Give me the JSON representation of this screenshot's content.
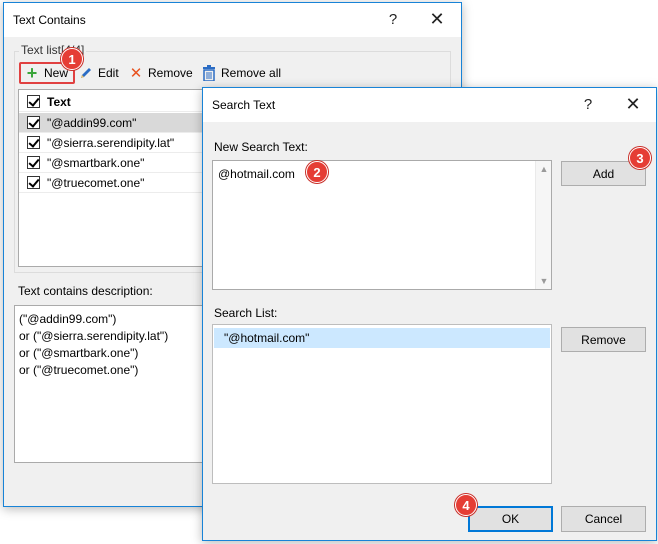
{
  "back_dialog": {
    "title": "Text Contains",
    "help": "?",
    "close": "✕",
    "group_label": "Text list[4/4]",
    "toolbar": {
      "new_label": "New",
      "edit_label": "Edit",
      "remove_label": "Remove",
      "remove_all_label": "Remove all"
    },
    "list_header": "Text",
    "list_items": [
      "\"@addin99.com\"",
      "\"@sierra.serendipity.lat\"",
      "\"@smartbark.one\"",
      "\"@truecomet.one\""
    ],
    "description_label": "Text contains description:",
    "description_lines": [
      "(\"@addin99.com\")",
      "or (\"@sierra.serendipity.lat\")",
      "or (\"@smartbark.one\")",
      "or (\"@truecomet.one\")"
    ]
  },
  "search_dialog": {
    "title": "Search Text",
    "help": "?",
    "close": "✕",
    "new_search_label": "New Search Text:",
    "new_search_value": "@hotmail.com",
    "add_label": "Add",
    "search_list_label": "Search List:",
    "search_list_items": [
      "\"@hotmail.com\""
    ],
    "remove_label": "Remove",
    "ok_label": "OK",
    "cancel_label": "Cancel"
  },
  "badges": [
    "1",
    "2",
    "3",
    "4"
  ],
  "colors": {
    "accent": "#0078d7",
    "badge": "#e53d35",
    "highlight": "#cce8ff",
    "new_icon": "#3aa53a",
    "remove_icon": "#e8521f"
  }
}
